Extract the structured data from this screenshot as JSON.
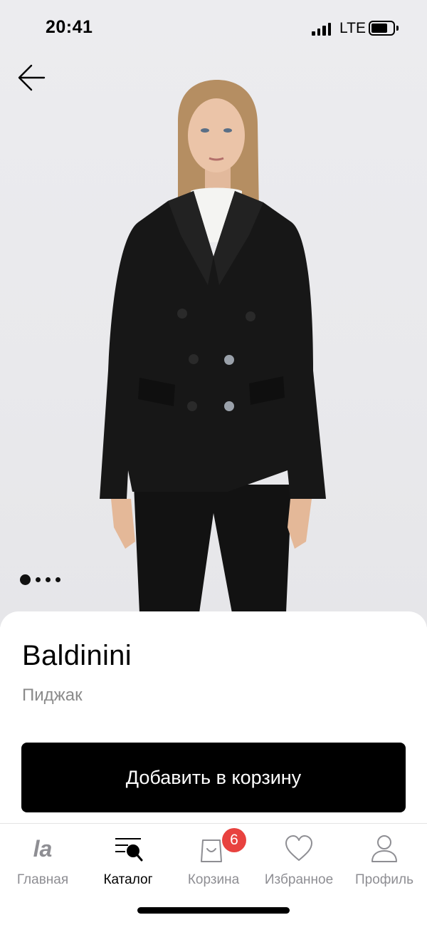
{
  "status_bar": {
    "time": "20:41",
    "network": "LTE"
  },
  "product": {
    "brand": "Baldinini",
    "type": "Пиджак",
    "image_count": 4,
    "active_image_index": 0
  },
  "actions": {
    "add_to_cart": "Добавить в корзину"
  },
  "tabbar": {
    "items": [
      {
        "label": "Главная",
        "icon": "home-logo-icon"
      },
      {
        "label": "Каталог",
        "icon": "catalog-search-icon"
      },
      {
        "label": "Корзина",
        "icon": "shopping-bag-icon"
      },
      {
        "label": "Избранное",
        "icon": "heart-icon"
      },
      {
        "label": "Профиль",
        "icon": "profile-icon"
      }
    ],
    "active": "Каталог",
    "cart_badge": "6"
  },
  "colors": {
    "accent_badge": "#e8423f",
    "button_bg": "#000000",
    "inactive_tab": "#8e8e93"
  }
}
